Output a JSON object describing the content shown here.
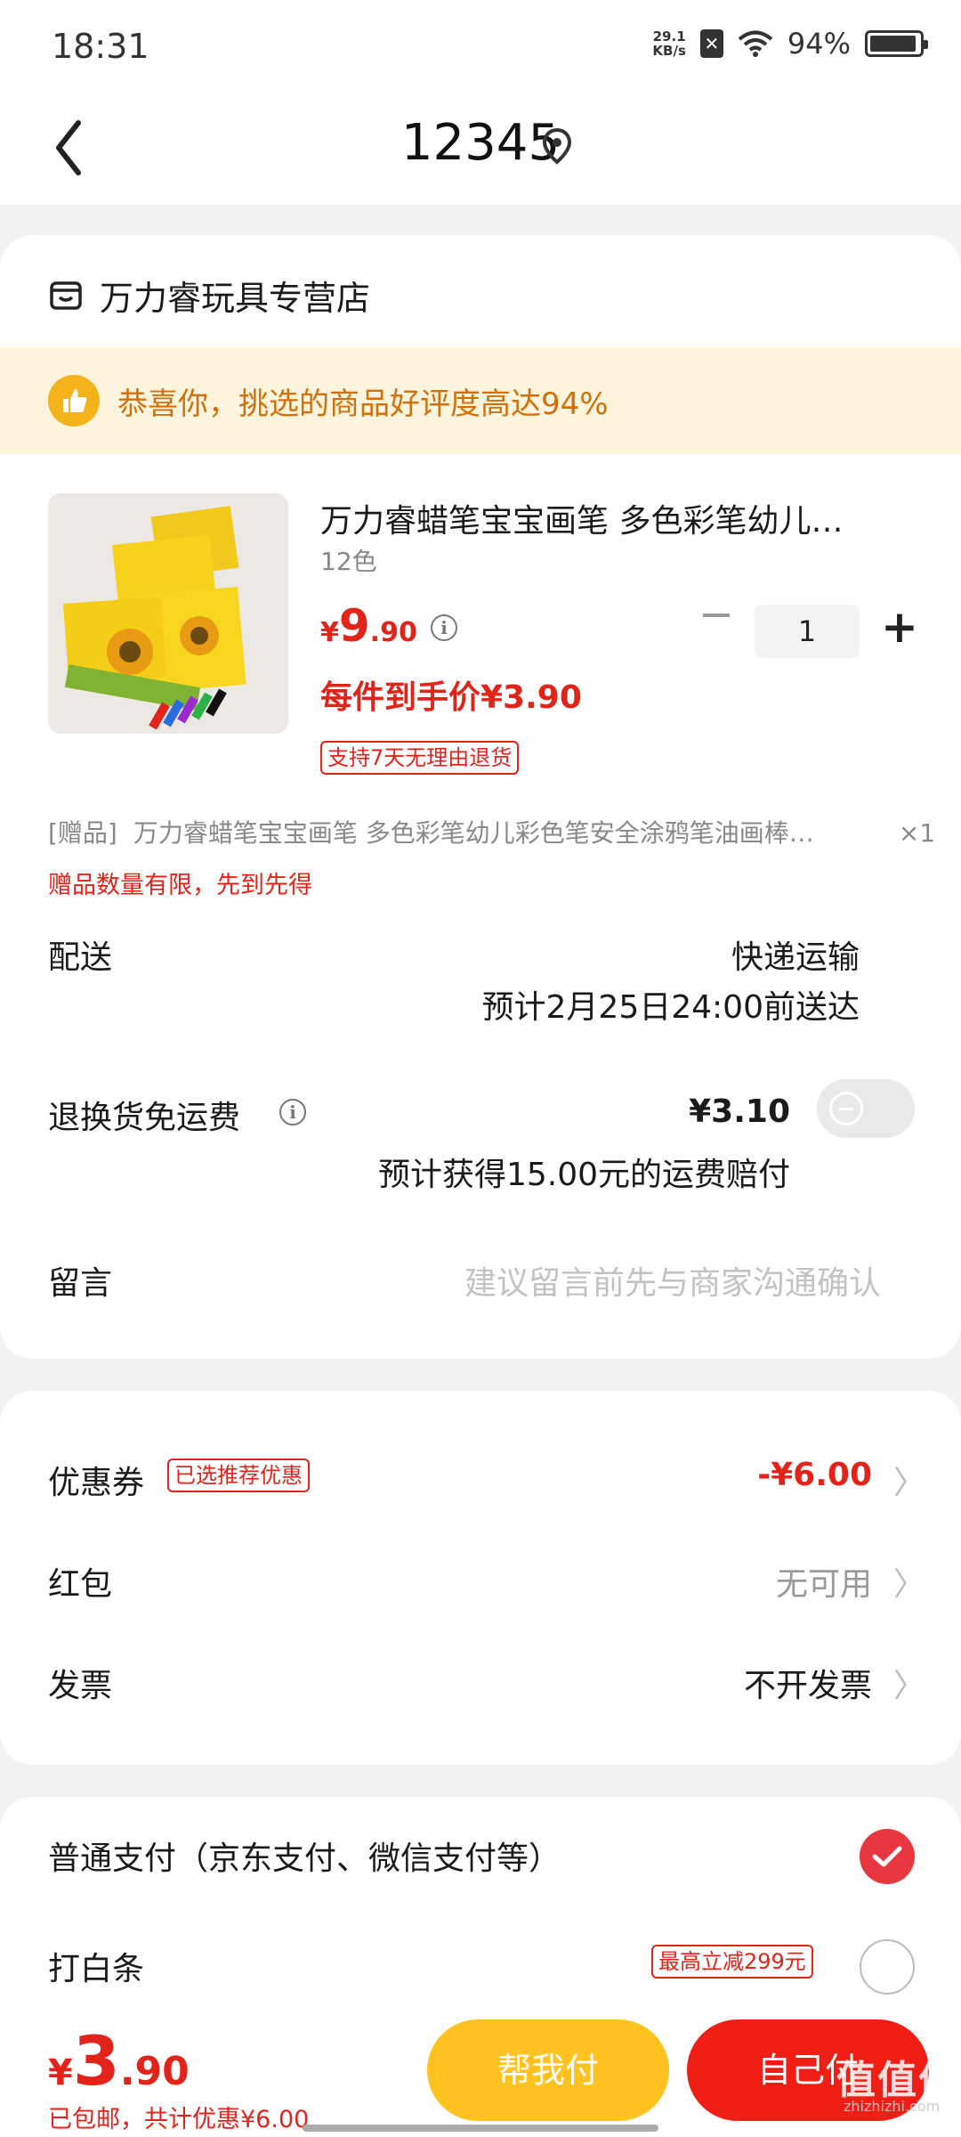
{
  "status": {
    "time": "18:31",
    "net_speed_top": "29.1",
    "net_speed_bottom": "KB/s",
    "battery": "94%",
    "battery_level": 0.94
  },
  "header": {
    "title": "12345"
  },
  "shop": {
    "name": "万力睿玩具专营店"
  },
  "banner": {
    "text": "恭喜你，挑选的商品好评度高达94%"
  },
  "product": {
    "name": "万力睿蜡笔宝宝画笔 多色彩笔幼儿…",
    "spec": "12色",
    "price_currency": "¥",
    "price_int": "9",
    "price_dec": ".90",
    "quantity": "1",
    "unit_price": "每件到手价¥3.90",
    "return_tag": "支持7天无理由退货"
  },
  "gift": {
    "label": "[赠品]",
    "title": "万力睿蜡笔宝宝画笔 多色彩笔幼儿彩色笔安全涂鸦笔油画棒…",
    "count": "×1",
    "note": "赠品数量有限，先到先得"
  },
  "delivery": {
    "label": "配送",
    "method": "快递运输",
    "eta": "预计2月25日24:00前送达"
  },
  "return_shipping": {
    "label": "退换货免运费",
    "price": "¥3.10",
    "note": "预计获得15.00元的运费赔付",
    "enabled": false
  },
  "message": {
    "label": "留言",
    "placeholder": "建议留言前先与商家沟通确认"
  },
  "coupon": {
    "label": "优惠券",
    "tag": "已选推荐优惠",
    "value": "-¥6.00"
  },
  "redpacket": {
    "label": "红包",
    "value": "无可用"
  },
  "invoice": {
    "label": "发票",
    "value": "不开发票"
  },
  "payment": {
    "normal_label": "普通支付（京东支付、微信支付等）",
    "baitiao_label": "打白条",
    "baitiao_tag": "最高立减299元"
  },
  "bottom": {
    "total_currency": "¥",
    "total_int": "3",
    "total_dec": ".90",
    "sub": "已包邮，共计优惠¥6.00",
    "help_pay": "帮我付",
    "self_pay": "自己付"
  },
  "watermark": {
    "text": "值值值",
    "sub": "zhizhizhi.com"
  },
  "colors": {
    "accent": "#e2231a",
    "banner_bg": "#fdf4dd",
    "banner_text": "#d1700a",
    "help_btn": "#ffc21e",
    "self_btn": "#f01e14"
  }
}
